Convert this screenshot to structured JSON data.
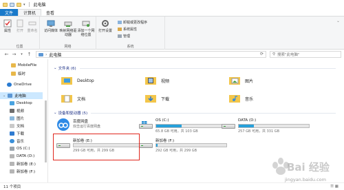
{
  "window": {
    "title": "此电脑"
  },
  "ribbon_tabs": [
    "文件",
    "计算机",
    "查看"
  ],
  "ribbon": {
    "location_group": {
      "label": "位置",
      "buttons": [
        "属性",
        "打开",
        "重命名"
      ]
    },
    "network_group": {
      "label": "网络",
      "buttons": [
        "访问媒体",
        "映射网络驱动器",
        "添加一个网络位置"
      ]
    },
    "system_group": {
      "label": "系统",
      "open_settings": "打开设置",
      "small": [
        "卸载或更改程序",
        "系统属性",
        "管理"
      ]
    }
  },
  "address": {
    "path": "此电脑",
    "search_placeholder": "搜索\"此电脑\""
  },
  "nav_pane": {
    "items": [
      {
        "label": "MobileFile",
        "icon": "folder-icon"
      },
      {
        "label": "临时",
        "icon": "folder-icon"
      },
      {
        "label": "OneDrive",
        "icon": "cloud-icon"
      },
      {
        "label": "此电脑",
        "icon": "computer-icon",
        "selected": true
      },
      {
        "label": "Desktop",
        "icon": "desktop-icon"
      },
      {
        "label": "视频",
        "icon": "video-icon"
      },
      {
        "label": "图片",
        "icon": "picture-icon"
      },
      {
        "label": "文档",
        "icon": "document-icon"
      },
      {
        "label": "下载",
        "icon": "download-icon"
      },
      {
        "label": "音乐",
        "icon": "music-icon"
      },
      {
        "label": "OS (C:)",
        "icon": "drive-icon"
      },
      {
        "label": "DATA (D:)",
        "icon": "drive-icon"
      },
      {
        "label": "新加卷 (E:)",
        "icon": "drive-icon"
      },
      {
        "label": "新加卷 (F:)",
        "icon": "drive-icon"
      }
    ]
  },
  "folders_group": {
    "header": "文件夹 (6)",
    "items": [
      {
        "label": "Desktop",
        "icon": "desktop-folder-icon"
      },
      {
        "label": "视频",
        "icon": "video-folder-icon"
      },
      {
        "label": "图片",
        "icon": "picture-folder-icon"
      },
      {
        "label": "文档",
        "icon": "document-folder-icon"
      },
      {
        "label": "下载",
        "icon": "download-folder-icon"
      },
      {
        "label": "音乐",
        "icon": "music-folder-icon"
      }
    ]
  },
  "devices_group": {
    "header": "设备和驱动器 (5)",
    "baidu": {
      "name": "百度网盘",
      "sub": "双击运行百度网盘"
    },
    "drives": [
      {
        "name": "OS (C:)",
        "free": "65.8 GB 可用，共 103 GB",
        "used_fraction": 0.36
      },
      {
        "name": "DATA (D:)",
        "free": "257 GB 可用，共 331 GB",
        "used_fraction": 0.22
      },
      {
        "name": "新加卷 (E:)",
        "free": "299 GB 可用，共 299 GB",
        "used_fraction": 0.0,
        "highlighted": true
      },
      {
        "name": "新加卷 (F:)",
        "free": "292 GB 可用，共 299 GB",
        "used_fraction": 0.02
      }
    ]
  },
  "status": {
    "items_count": "11 个项目"
  },
  "watermark": {
    "logo": "Bai 经验",
    "url": "jingyan.baidu.com"
  },
  "colors": {
    "accent": "#1979ca",
    "bar_fill": "#26a0da",
    "highlight_box": "#e0251c",
    "selected": "#cce8ff"
  }
}
